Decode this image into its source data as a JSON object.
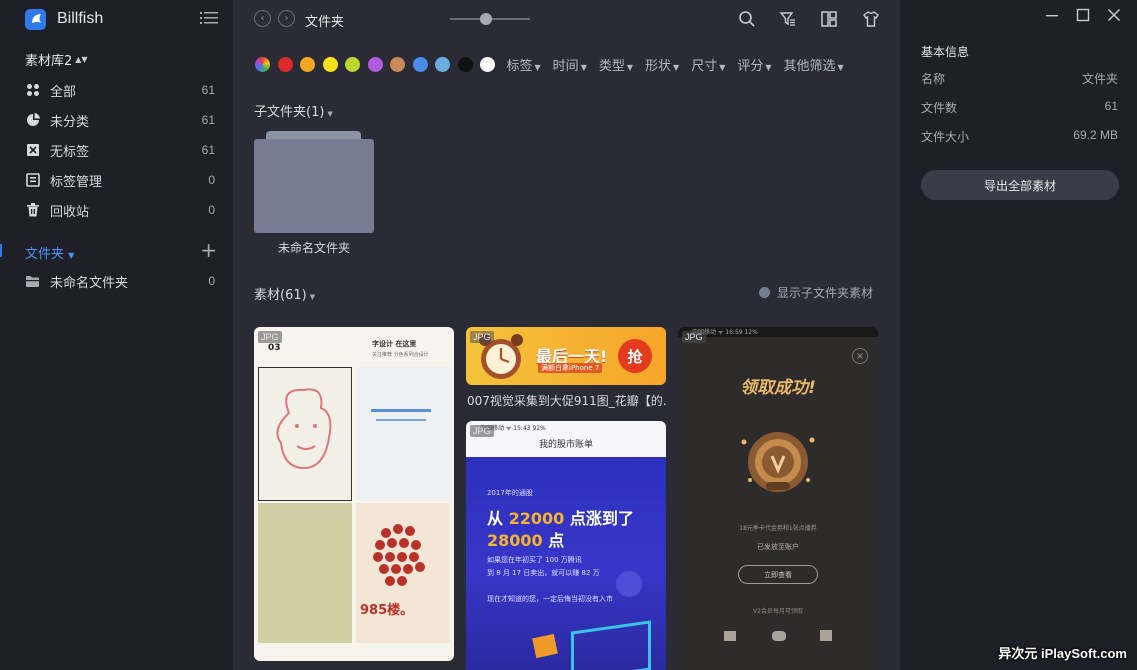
{
  "app": {
    "name": "Billfish",
    "library": "素材库2"
  },
  "sidebar": {
    "items": [
      {
        "label": "全部",
        "count": "61",
        "icon": "grid-icon"
      },
      {
        "label": "未分类",
        "count": "61",
        "icon": "pie-icon"
      },
      {
        "label": "无标签",
        "count": "61",
        "icon": "no-tag-icon"
      },
      {
        "label": "标签管理",
        "count": "0",
        "icon": "tag-manage-icon"
      },
      {
        "label": "回收站",
        "count": "0",
        "icon": "trash-icon"
      }
    ],
    "folders_label": "文件夹",
    "folders": [
      {
        "label": "未命名文件夹",
        "count": "0"
      }
    ]
  },
  "toolbar": {
    "breadcrumb": "文件夹",
    "zoom_level": 0.45
  },
  "filters": {
    "colors": [
      "#dd2a2a",
      "#f5a623",
      "#f8e01d",
      "#bfd62f",
      "#b05be0",
      "#c98a5a",
      "#4a8ae8",
      "#6aaee0",
      "#111111",
      "#ffffff"
    ],
    "labels": [
      "标签",
      "时间",
      "类型",
      "形状",
      "尺寸",
      "评分",
      "其他筛选"
    ]
  },
  "subfolders": {
    "title": "子文件夹(1)",
    "items": [
      {
        "name": "未命名文件夹"
      }
    ]
  },
  "assets": {
    "title": "素材(61)",
    "show_sub_label": "显示子文件夹素材",
    "items": [
      {
        "badge": "JPG",
        "caption": ""
      },
      {
        "badge": "JPG",
        "caption": "007视觉采集到大促911图_花瓣【的..."
      },
      {
        "badge": "JPG",
        "caption": ""
      },
      {
        "badge": "JPG",
        "caption": ""
      }
    ],
    "thumb_text": {
      "banner_title": "最后一天!",
      "banner_sub": "满额白拿iPhone 7",
      "banner_btn": "抢",
      "stock_status": "中国移动 ᯤ    15:43    92%",
      "stock_header": "我的股市账单",
      "stock_year": "2017年的通股",
      "stock_line1_pre": "从 ",
      "stock_line1_num": "22000",
      "stock_line1_post": " 点涨到了",
      "stock_line2_num": "28000",
      "stock_line2_post": " 点",
      "stock_line3": "如果您在年初买了 100 万腾讯",
      "stock_line4": "到 8 月 17 日卖出，就可以赚 82 万",
      "stock_line5": "现在才知道的您，一定后悔当初没有入市",
      "dark_status": "中国移动 ᯤ    16:59    12%",
      "dark_title": "领取成功!",
      "dark_text1": "18元季卡代金券和1张点播券",
      "dark_text2": "已发放至账户",
      "dark_btn": "立即查看",
      "dark_text3": "V2会员每月可领取",
      "poster_header1": "字设计 在这里",
      "poster_header2": "关注推荐 分色系列合设计",
      "poster_big": "985楼。",
      "poster_num": "03"
    }
  },
  "panel": {
    "title": "基本信息",
    "rows": [
      {
        "key": "名称",
        "value": "文件夹"
      },
      {
        "key": "文件数",
        "value": "61"
      },
      {
        "key": "文件大小",
        "value": "69.2 MB"
      }
    ],
    "export_label": "导出全部素材"
  },
  "watermark": "异次元 iPlaySoft.com"
}
